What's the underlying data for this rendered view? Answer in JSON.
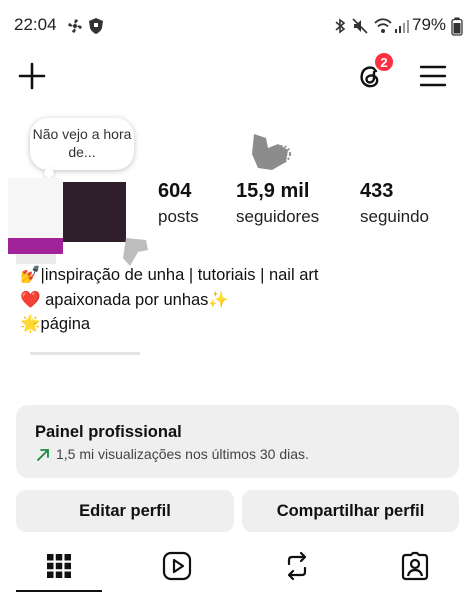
{
  "status_bar": {
    "time": "22:04",
    "battery": "79%",
    "icons": [
      "fan-icon",
      "shield-icon",
      "bluetooth-icon",
      "mute-icon",
      "wifi-icon",
      "signal-icon",
      "battery-icon"
    ]
  },
  "toolbar": {
    "create_icon": "plus-icon",
    "threads_icon": "threads-icon",
    "threads_badge": "2",
    "menu_icon": "hamburger-menu-icon"
  },
  "profile": {
    "note": "Não vejo a hora de...",
    "stats": [
      {
        "value": "604",
        "label": "posts"
      },
      {
        "value": "15,9 mil",
        "label": "seguidores"
      },
      {
        "value": "433",
        "label": "seguindo"
      }
    ],
    "bio": [
      {
        "emoji": "💅",
        "text": "|inspiração de unha | tutoriais | nail art"
      },
      {
        "emoji": "❤️",
        "text": " apaixonada por unhas✨"
      },
      {
        "emoji": "🌟",
        "text": "página"
      }
    ]
  },
  "dashboard": {
    "title": "Painel profissional",
    "subtitle": "1,5 mi visualizações nos últimos 30 dias.",
    "trend_color": "#1a8a3a"
  },
  "actions": {
    "edit": "Editar perfil",
    "share": "Compartilhar perfil"
  },
  "tabs": [
    "grid-icon",
    "reels-icon",
    "reposts-icon",
    "tagged-icon"
  ],
  "colors": {
    "badge": "#ff2e40",
    "button_bg": "#efefef",
    "avatar_dark": "#2e1f2b",
    "avatar_magenta": "#a0239a"
  }
}
